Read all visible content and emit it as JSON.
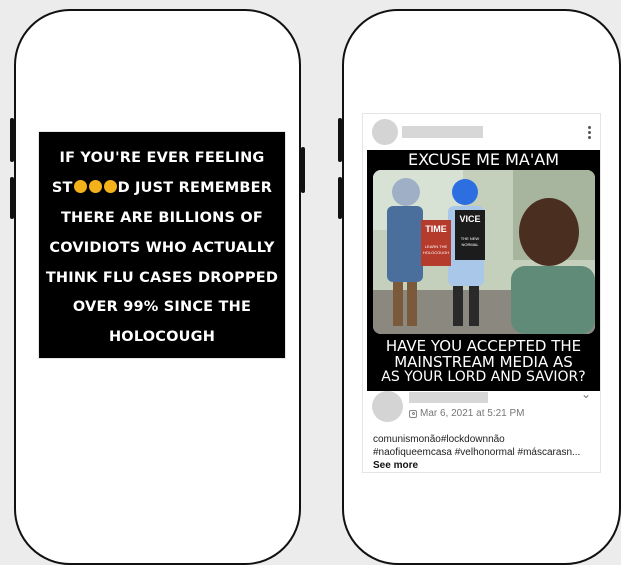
{
  "left_phone": {
    "meme": {
      "lines": [
        "IF YOU'RE EVER FEELING",
        "ST",
        "D JUST REMEMBER",
        "THERE ARE BILLIONS OF",
        "COVIDIOTS WHO ACTUALLY",
        "THINK FLU CASES DROPPED",
        "OVER 99% SINCE THE",
        "HOLOCOUGH"
      ]
    }
  },
  "right_phone": {
    "post": {
      "meme_top_text": "EXCUSE ME MA'AM",
      "meme_bottom_text": [
        "HAVE YOU ACCEPTED THE",
        "MAINSTREAM MEDIA AS",
        "AS YOUR LORD AND SAVIOR?"
      ],
      "magazine_left": {
        "masthead": "TIME",
        "cover_text": [
          "LEARN THE",
          "HOLOCOUGH"
        ]
      },
      "magazine_right": {
        "masthead": "VICE",
        "cover_text": [
          "THE NEW",
          "NORMAL"
        ]
      },
      "timestamp": "Mar 6, 2021 at 5:21 PM",
      "description_lines": [
        "comunismonão#lockdownnão",
        "#naofiqueemcasa #velhonormal #máscarasn..."
      ],
      "see_more": "See more"
    }
  },
  "colors": {
    "page_background": "#ececec",
    "phone_frame": "#111111",
    "meme_text": "#ffffff",
    "redaction": "#d7d7d7"
  }
}
